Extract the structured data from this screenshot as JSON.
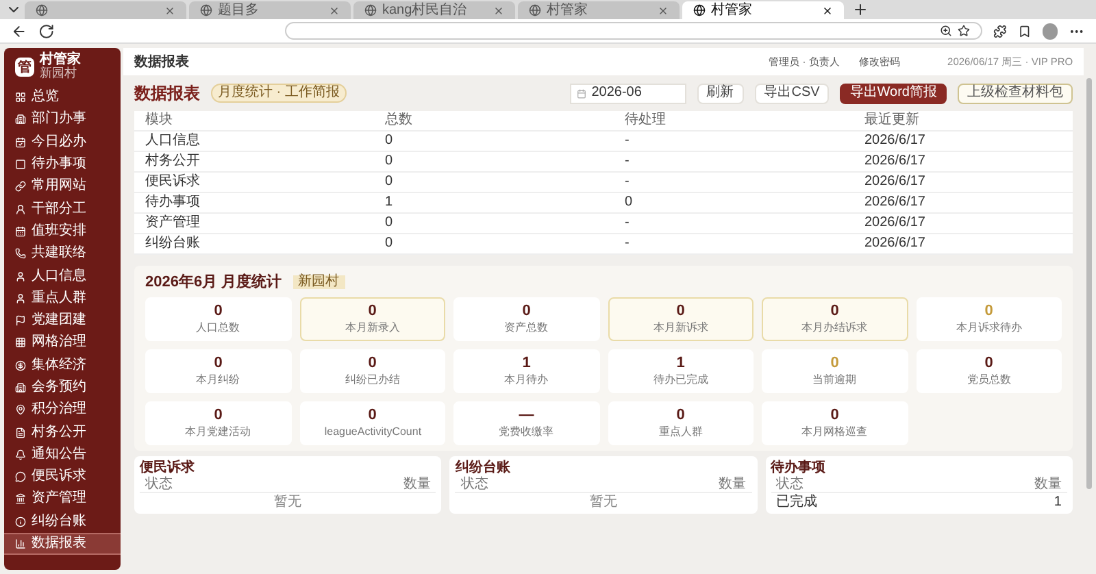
{
  "browser": {
    "tabs": [
      {
        "selected": false
      },
      {
        "title": "题目多",
        "selected": false
      },
      {
        "title": "kang村民自治",
        "selected": false
      },
      {
        "title": "村管家",
        "selected": false
      },
      {
        "title": "村管家",
        "selected": true
      }
    ]
  },
  "sidebar": {
    "logo": "管",
    "app_name": "村管家",
    "village": "新园村",
    "items": [
      {
        "label": "总览",
        "selected": false
      },
      {
        "label": "部门办事",
        "selected": false
      },
      {
        "label": "今日必办",
        "selected": false
      },
      {
        "label": "待办事项",
        "selected": false
      },
      {
        "label": "常用网站",
        "selected": false
      },
      {
        "label": "干部分工",
        "selected": false
      },
      {
        "label": "值班安排",
        "selected": false
      },
      {
        "label": "共建联络",
        "selected": false
      },
      {
        "label": "人口信息",
        "selected": false
      },
      {
        "label": "重点人群",
        "selected": false
      },
      {
        "label": "党建团建",
        "selected": false
      },
      {
        "label": "网格治理",
        "selected": false
      },
      {
        "label": "集体经济",
        "selected": false
      },
      {
        "label": "会务预约",
        "selected": false
      },
      {
        "label": "积分治理",
        "selected": false
      },
      {
        "label": "村务公开",
        "selected": false
      },
      {
        "label": "通知公告",
        "selected": false
      },
      {
        "label": "便民诉求",
        "selected": false
      },
      {
        "label": "资产管理",
        "selected": false
      },
      {
        "label": "纠纷台账",
        "selected": false
      },
      {
        "label": "数据报表",
        "selected": true
      }
    ]
  },
  "header": {
    "title": "数据报表",
    "user": "管理员 · 负责人",
    "change_password": "修改密码",
    "info": "2026/06/17 周三 · VIP PRO"
  },
  "toolbar": {
    "title": "数据报表",
    "badge": "月度统计 · 工作简报",
    "month": "2026-06",
    "buttons": [
      {
        "label": "刷新",
        "kind": "plain"
      },
      {
        "label": "导出CSV",
        "kind": "plain"
      },
      {
        "label": "导出Word简报",
        "kind": "primary"
      },
      {
        "label": "上级检查材料包",
        "kind": "outline"
      }
    ]
  },
  "table": {
    "columns": [
      "模块",
      "总数",
      "待处理",
      "最近更新"
    ],
    "rows": [
      [
        "人口信息",
        "0",
        "-",
        "2026/6/17"
      ],
      [
        "村务公开",
        "0",
        "-",
        "2026/6/17"
      ],
      [
        "便民诉求",
        "0",
        "-",
        "2026/6/17"
      ],
      [
        "待办事项",
        "1",
        "0",
        "2026/6/17"
      ],
      [
        "资产管理",
        "0",
        "-",
        "2026/6/17"
      ],
      [
        "纠纷台账",
        "0",
        "-",
        "2026/6/17"
      ]
    ]
  },
  "monthly": {
    "title": "2026年6月 月度统计",
    "badge": "新园村",
    "stats": [
      {
        "value": "0",
        "label": "人口总数",
        "highlighted": false,
        "warning": false
      },
      {
        "value": "0",
        "label": "本月新录入",
        "highlighted": true,
        "warning": false
      },
      {
        "value": "0",
        "label": "资产总数",
        "highlighted": false,
        "warning": false
      },
      {
        "value": "0",
        "label": "本月新诉求",
        "highlighted": true,
        "warning": false
      },
      {
        "value": "0",
        "label": "本月办结诉求",
        "highlighted": true,
        "warning": false
      },
      {
        "value": "0",
        "label": "本月诉求待办",
        "highlighted": false,
        "warning": true
      },
      {
        "value": "0",
        "label": "本月纠纷",
        "highlighted": false,
        "warning": false
      },
      {
        "value": "0",
        "label": "纠纷已办结",
        "highlighted": false,
        "warning": false
      },
      {
        "value": "1",
        "label": "本月待办",
        "highlighted": false,
        "warning": false
      },
      {
        "value": "1",
        "label": "待办已完成",
        "highlighted": false,
        "warning": false
      },
      {
        "value": "0",
        "label": "当前逾期",
        "highlighted": false,
        "warning": true
      },
      {
        "value": "0",
        "label": "党员总数",
        "highlighted": false,
        "warning": false
      },
      {
        "value": "0",
        "label": "本月党建活动",
        "highlighted": false,
        "warning": false
      },
      {
        "value": "0",
        "label": "leagueActivityCount",
        "highlighted": false,
        "warning": false
      },
      {
        "value": "—",
        "label": "党费收缴率",
        "highlighted": false,
        "warning": false
      },
      {
        "value": "0",
        "label": "重点人群",
        "highlighted": false,
        "warning": false
      },
      {
        "value": "0",
        "label": "本月网格巡查",
        "highlighted": false,
        "warning": false
      }
    ]
  },
  "panels": [
    {
      "title": "便民诉求",
      "columns": [
        "状态",
        "数量"
      ],
      "empty": "暂无"
    },
    {
      "title": "纠纷台账",
      "columns": [
        "状态",
        "数量"
      ],
      "empty": "暂无"
    },
    {
      "title": "待办事项",
      "columns": [
        "状态",
        "数量"
      ],
      "rows": [
        [
          "已完成",
          "1"
        ]
      ]
    }
  ]
}
